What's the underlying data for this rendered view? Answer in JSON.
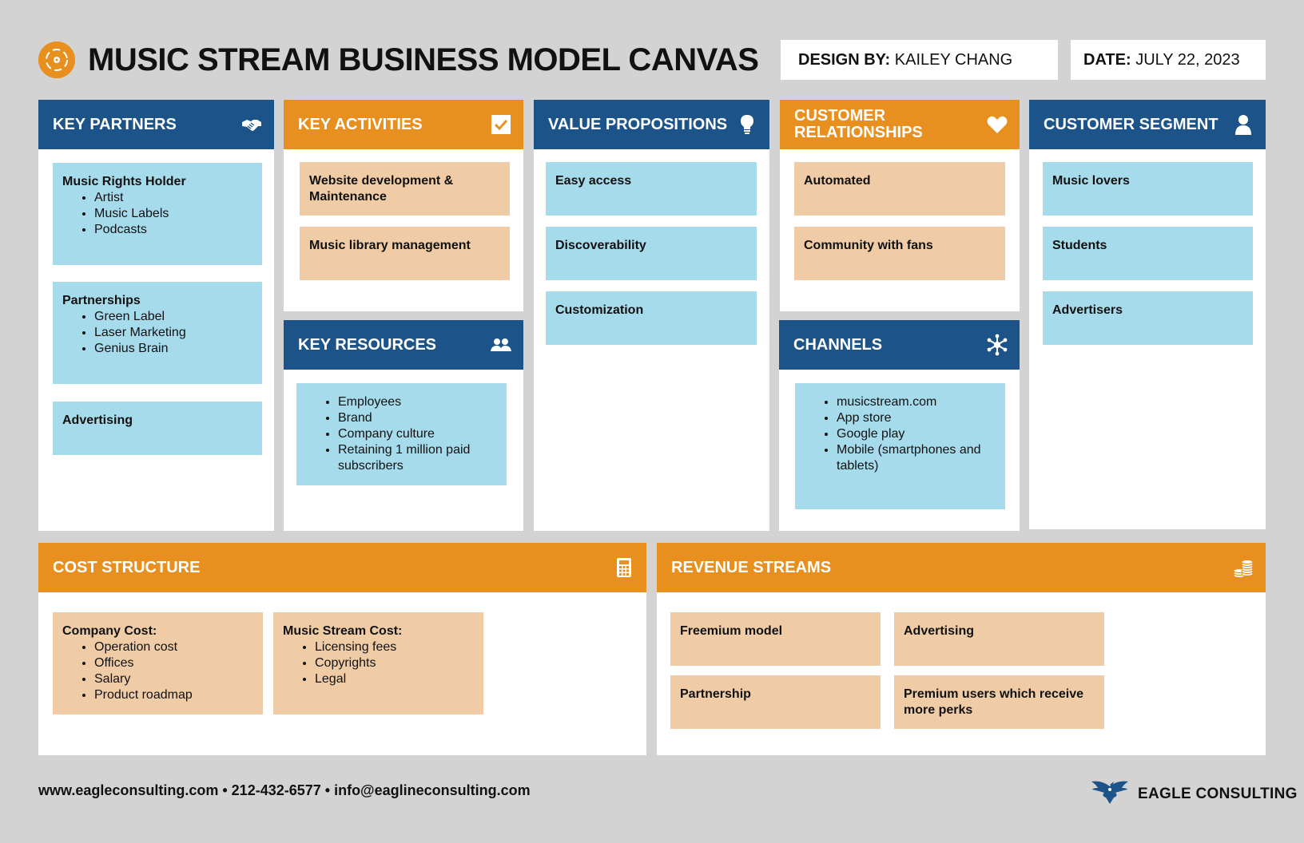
{
  "header": {
    "title": "MUSIC STREAM BUSINESS MODEL CANVAS",
    "design_by_label": "DESIGN BY:",
    "design_by_value": "KAILEY CHANG",
    "date_label": "DATE:",
    "date_value": "JULY 22, 2023",
    "logo_icon": "vinyl-disc-icon"
  },
  "colors": {
    "blue": "#1c5489",
    "orange": "#e8901f",
    "light_blue": "#a6dbec",
    "peach": "#f0cca6",
    "background": "#d3d3d3"
  },
  "key_partners": {
    "title": "KEY PARTNERS",
    "icon": "handshake-icon",
    "cards": [
      {
        "title": "Music Rights Holder",
        "items": [
          "Artist",
          "Music Labels",
          "Podcasts"
        ]
      },
      {
        "title": "Partnerships",
        "items": [
          "Green Label",
          "Laser Marketing",
          "Genius Brain"
        ]
      },
      {
        "title": "Advertising"
      }
    ]
  },
  "key_activities": {
    "title": "KEY ACTIVITIES",
    "icon": "checkbox-icon",
    "cards": [
      {
        "title": "Website development & Maintenance"
      },
      {
        "title": "Music library management"
      }
    ]
  },
  "key_resources": {
    "title": "KEY RESOURCES",
    "icon": "people-icon",
    "items": [
      "Employees",
      "Brand",
      "Company culture",
      "Retaining 1 million paid subscribers"
    ]
  },
  "value_propositions": {
    "title": "VALUE PROPOSITIONS",
    "icon": "lightbulb-icon",
    "cards": [
      {
        "title": "Easy access"
      },
      {
        "title": "Discoverability"
      },
      {
        "title": "Customization"
      }
    ]
  },
  "customer_relationships": {
    "title": "CUSTOMER RELATIONSHIPS",
    "icon": "heart-icon",
    "cards": [
      {
        "title": "Automated"
      },
      {
        "title": "Community with fans"
      }
    ]
  },
  "channels": {
    "title": "CHANNELS",
    "icon": "network-icon",
    "items": [
      "musicstream.com",
      "App store",
      "Google play",
      "Mobile (smartphones and tablets)"
    ]
  },
  "customer_segment": {
    "title": "CUSTOMER SEGMENT",
    "icon": "person-icon",
    "cards": [
      {
        "title": "Music lovers"
      },
      {
        "title": "Students"
      },
      {
        "title": "Advertisers"
      }
    ]
  },
  "cost_structure": {
    "title": "COST STRUCTURE",
    "icon": "calculator-icon",
    "cards": [
      {
        "title": "Company Cost:",
        "items": [
          "Operation cost",
          "Offices",
          "Salary",
          "Product roadmap"
        ]
      },
      {
        "title": "Music Stream Cost:",
        "items": [
          "Licensing fees",
          "Copyrights",
          "Legal"
        ]
      }
    ]
  },
  "revenue_streams": {
    "title": "REVENUE STREAMS",
    "icon": "coins-icon",
    "cards": [
      {
        "title": "Freemium model"
      },
      {
        "title": "Advertising"
      },
      {
        "title": "Partnership"
      },
      {
        "title": "Premium users which receive more perks"
      }
    ]
  },
  "footer": {
    "contact": "www.eagleconsulting.com • 212-432-6577 • info@eaglineconsulting.com",
    "brand_name": "EAGLE CONSULTING",
    "brand_icon": "eagle-icon"
  }
}
